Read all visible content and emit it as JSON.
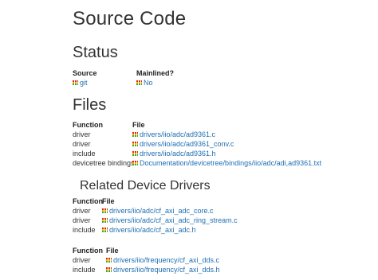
{
  "page_title": "Source Code",
  "status": {
    "heading": "Status",
    "col_source": "Source",
    "col_mainlined": "Mainlined?",
    "source_value": "git",
    "mainlined_value": "No"
  },
  "files": {
    "heading": "Files",
    "col_function": "Function",
    "col_file": "File",
    "rows": [
      {
        "function": "driver",
        "file": "drivers/iio/adc/ad9361.c"
      },
      {
        "function": "driver",
        "file": "drivers/iio/adc/ad9361_conv.c"
      },
      {
        "function": "include",
        "file": "drivers/iio/adc/ad9361.h"
      },
      {
        "function": "devicetree bindings",
        "file": "Documentation/devicetree/bindings/iio/adc/adi,ad9361.txt"
      }
    ]
  },
  "related": {
    "heading": "Related Device Drivers",
    "table1": {
      "col_function": "Function",
      "col_file": "File",
      "rows": [
        {
          "function": "driver",
          "file": "drivers/iio/adc/cf_axi_adc_core.c"
        },
        {
          "function": "driver",
          "file": "drivers/iio/adc/cf_axi_adc_ring_stream.c"
        },
        {
          "function": "include",
          "file": "drivers/iio/adc/cf_axi_adc.h"
        }
      ]
    },
    "table2": {
      "col_function": "Function",
      "col_file": "File",
      "rows": [
        {
          "function": "driver",
          "file": "drivers/iio/frequency/cf_axi_dds.c"
        },
        {
          "function": "include",
          "file": "drivers/iio/frequency/cf_axi_dds.h"
        }
      ]
    }
  },
  "icon": "git-icon",
  "colors": {
    "link": "#1f6fb2",
    "text": "#333333",
    "git_red": "#e2231a",
    "git_yellow": "#f7b500",
    "git_green": "#3aa535"
  }
}
